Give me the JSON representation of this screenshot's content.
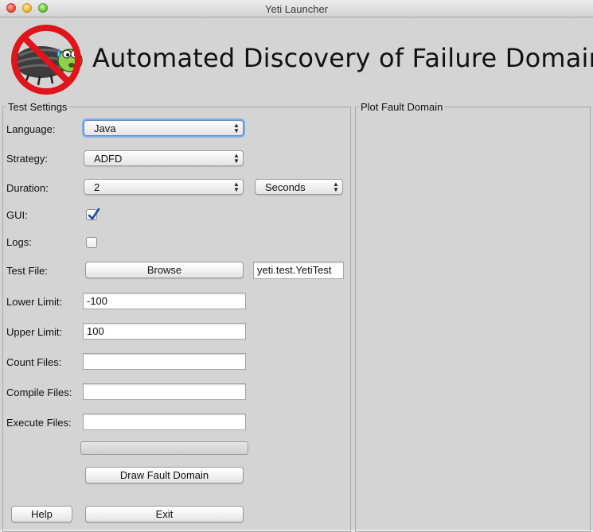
{
  "window": {
    "title": "Yeti Launcher"
  },
  "header": {
    "headline": "Automated Discovery of Failure Domain",
    "logo_icon": "no-bug-logo-icon"
  },
  "test_settings": {
    "legend": "Test Settings",
    "language": {
      "label": "Language:",
      "value": "Java"
    },
    "strategy": {
      "label": "Strategy:",
      "value": "ADFD"
    },
    "duration": {
      "label": "Duration:",
      "value": "2",
      "unit": "Seconds"
    },
    "gui": {
      "label": "GUI:",
      "checked": true
    },
    "logs": {
      "label": "Logs:",
      "checked": false
    },
    "test_file": {
      "label": "Test File:",
      "browse_label": "Browse",
      "value": "yeti.test.YetiTest"
    },
    "lower_limit": {
      "label": "Lower Limit:",
      "value": "-100"
    },
    "upper_limit": {
      "label": "Upper Limit:",
      "value": "100"
    },
    "count_files": {
      "label": "Count Files:",
      "value": ""
    },
    "compile_files": {
      "label": "Compile Files:",
      "value": ""
    },
    "execute_files": {
      "label": "Execute Files:",
      "value": ""
    },
    "progress": {
      "fraction": 0
    },
    "draw_button": "Draw Fault Domain",
    "help_button": "Help",
    "exit_button": "Exit"
  },
  "plot_panel": {
    "legend": "Plot Fault Domain"
  },
  "colors": {
    "check_mark": "#1a4fa8",
    "focus_ring": "#7eaee6",
    "logo_red": "#e0141b"
  }
}
